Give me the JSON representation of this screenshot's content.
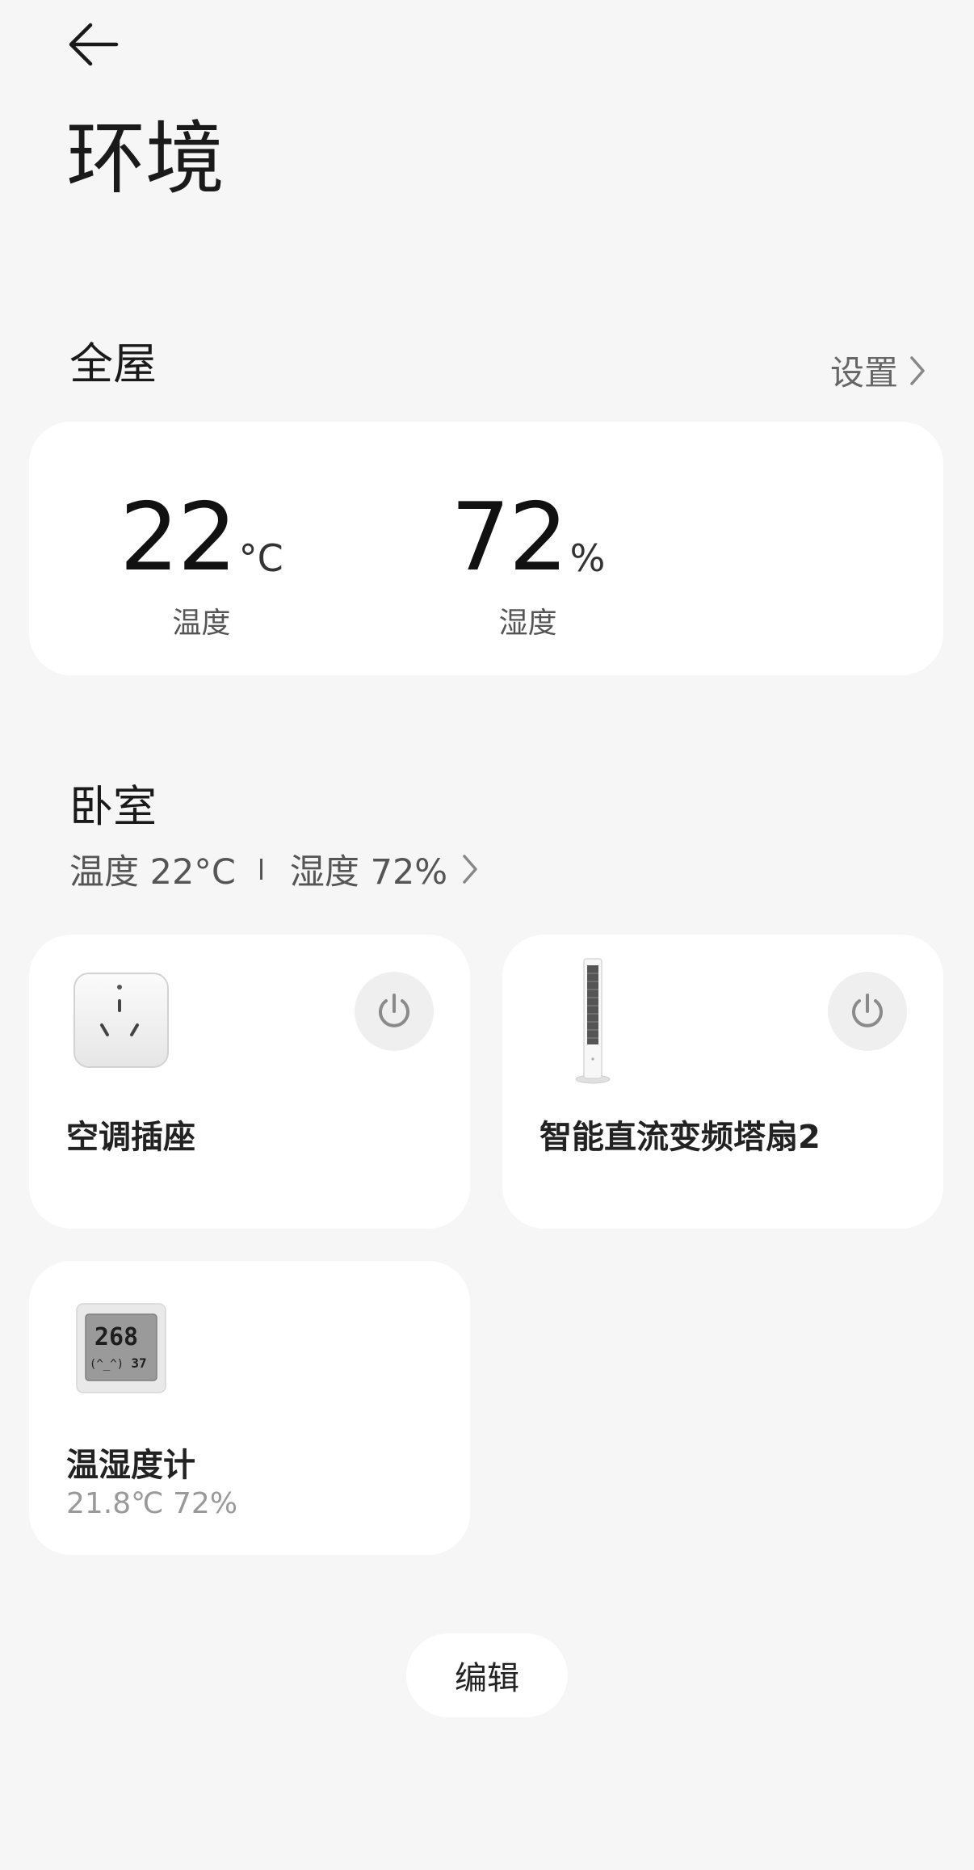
{
  "header": {
    "back_icon": "arrow-left-icon",
    "title": "环境"
  },
  "whole_house": {
    "title": "全屋",
    "settings_label": "设置",
    "temperature": {
      "value": "22",
      "unit": "°C",
      "label": "温度"
    },
    "humidity": {
      "value": "72",
      "unit": "%",
      "label": "湿度"
    }
  },
  "room": {
    "name": "卧室",
    "temp_stat": "温度 22°C",
    "humidity_stat": "湿度 72%"
  },
  "devices": [
    {
      "name": "空调插座",
      "icon": "smart-plug-icon",
      "has_power": true,
      "power_state": "off"
    },
    {
      "name": "智能直流变频塔扇2",
      "icon": "tower-fan-icon",
      "has_power": true,
      "power_state": "off"
    },
    {
      "name": "温湿度计",
      "icon": "hygrometer-icon",
      "status": "21.8℃ 72%",
      "screen_temp": "268",
      "screen_face": "(^_^)",
      "screen_humidity": "37"
    }
  ],
  "edit_label": "编辑",
  "colors": {
    "background": "#f6f6f6",
    "card": "#ffffff",
    "power_button": "#efefef"
  }
}
